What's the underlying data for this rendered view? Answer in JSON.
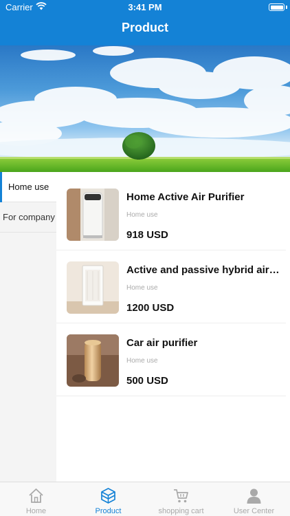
{
  "status_bar": {
    "carrier": "Carrier",
    "time": "3:41 PM"
  },
  "nav": {
    "title": "Product"
  },
  "categories": [
    {
      "label": "Home use",
      "active": true
    },
    {
      "label": "For company",
      "active": false
    }
  ],
  "products": [
    {
      "name": "Home Active Air Purifier",
      "category": "Home use",
      "price": "918 USD"
    },
    {
      "name": "Active and passive hybrid air purifier",
      "category": "Home use",
      "price": "1200 USD"
    },
    {
      "name": "Car air purifier",
      "category": "Home use",
      "price": "500 USD"
    }
  ],
  "tabbar": {
    "items": [
      {
        "label": "Home",
        "icon": "home-icon",
        "active": false
      },
      {
        "label": "Product",
        "icon": "product-box-icon",
        "active": true
      },
      {
        "label": "shopping cart",
        "icon": "shopping-cart-icon",
        "active": false
      },
      {
        "label": "User Center",
        "icon": "user-icon",
        "active": false
      }
    ]
  },
  "colors": {
    "accent": "#1482d6",
    "inactive": "#a9a9a9",
    "sidebar_bg": "#f4f4f4"
  }
}
